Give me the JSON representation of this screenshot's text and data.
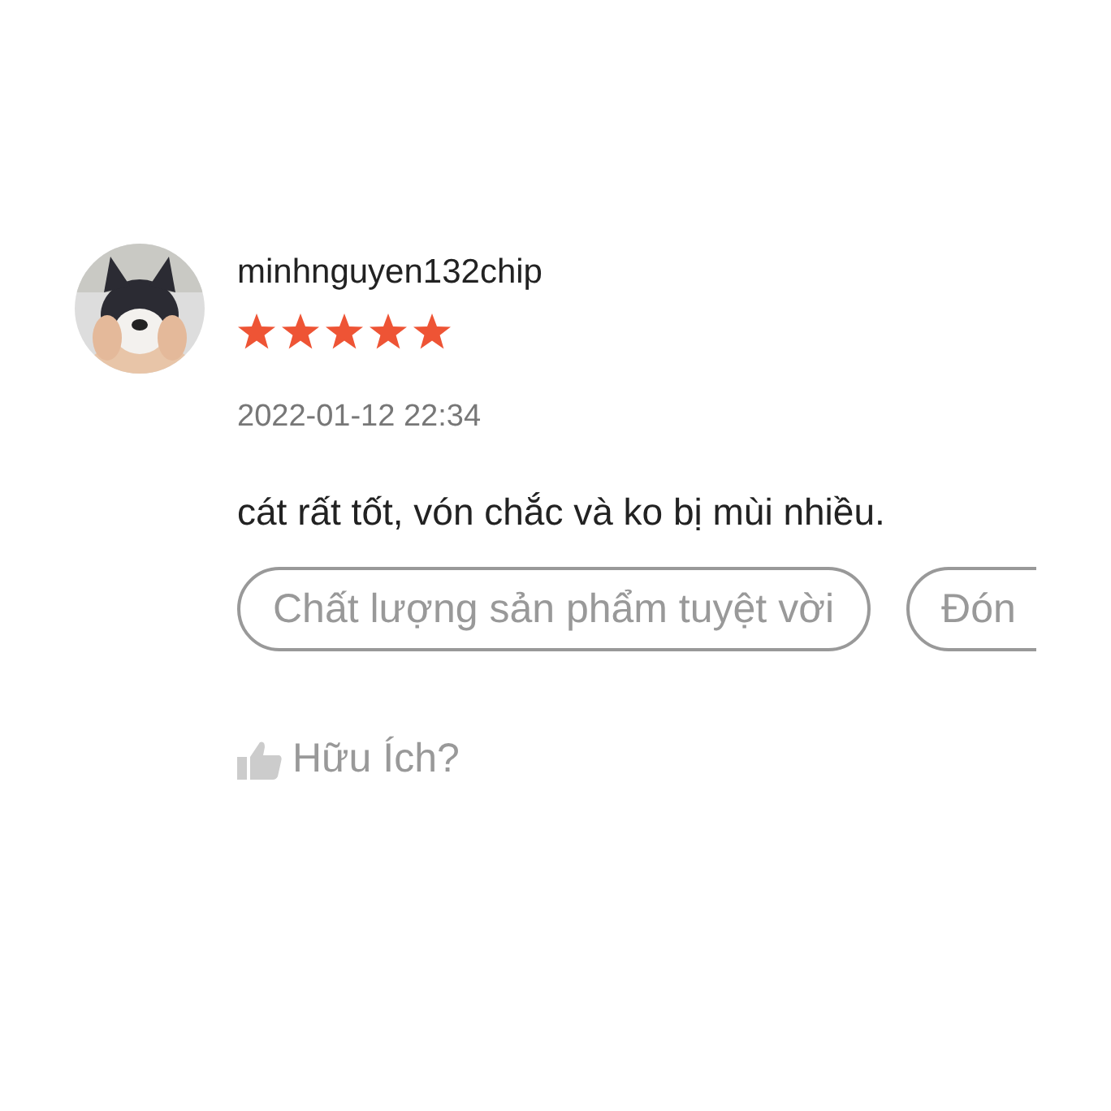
{
  "review": {
    "username": "minhnguyen132chip",
    "stars": 5,
    "date": "2022-01-12 22:34",
    "comment": "cát rất tốt, vón chắc và ko bị mùi nhiều.",
    "tags": [
      "Chất lượng sản phẩm tuyệt vời",
      "Đón"
    ],
    "helpful": "Hữu Ích?"
  }
}
